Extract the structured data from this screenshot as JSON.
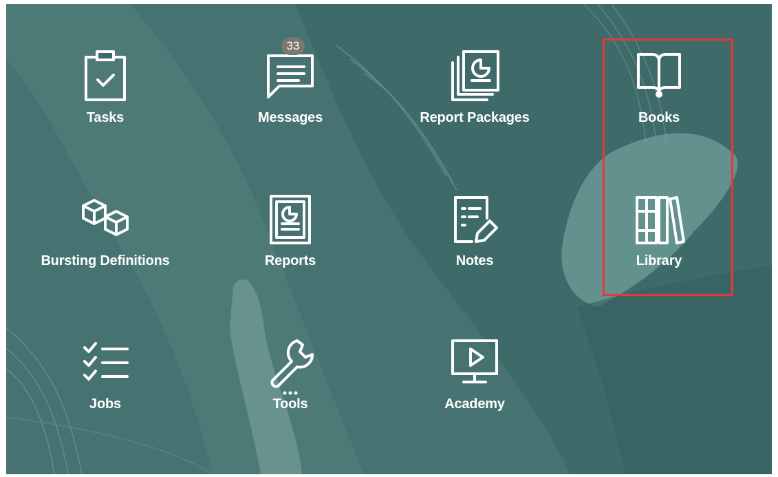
{
  "tiles": [
    {
      "label": "Tasks",
      "icon": "clipboard-check-icon"
    },
    {
      "label": "Messages",
      "icon": "message-icon",
      "badge": "33"
    },
    {
      "label": "Report Packages",
      "icon": "report-packages-icon"
    },
    {
      "label": "Books",
      "icon": "book-icon"
    },
    {
      "label": "Bursting Definitions",
      "icon": "cubes-icon"
    },
    {
      "label": "Reports",
      "icon": "report-icon"
    },
    {
      "label": "Notes",
      "icon": "note-edit-icon"
    },
    {
      "label": "Library",
      "icon": "library-icon"
    },
    {
      "label": "Jobs",
      "icon": "checklist-icon"
    },
    {
      "label": "Tools",
      "icon": "wrench-icon"
    },
    {
      "label": "Academy",
      "icon": "monitor-play-icon"
    }
  ],
  "highlighted_tiles": [
    "Books",
    "Library"
  ],
  "colors": {
    "background": "#3e6b6a",
    "highlight_border": "#e8373a",
    "badge": "#7b7670",
    "icon": "#ffffff"
  }
}
